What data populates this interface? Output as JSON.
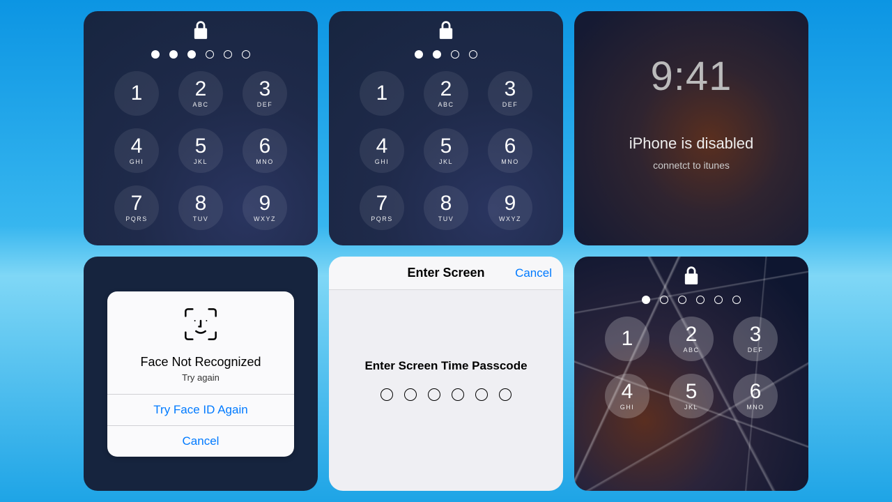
{
  "keypad": [
    {
      "num": "1",
      "sub": ""
    },
    {
      "num": "2",
      "sub": "ABC"
    },
    {
      "num": "3",
      "sub": "DEF"
    },
    {
      "num": "4",
      "sub": "GHI"
    },
    {
      "num": "5",
      "sub": "JKL"
    },
    {
      "num": "6",
      "sub": "MNO"
    },
    {
      "num": "7",
      "sub": "PQRS"
    },
    {
      "num": "8",
      "sub": "TUV"
    },
    {
      "num": "9",
      "sub": "WXYZ"
    }
  ],
  "panel1": {
    "dots_total": 6,
    "dots_filled": 3
  },
  "panel2": {
    "dots_total": 4,
    "dots_filled": 2
  },
  "panel3": {
    "time": "9:41",
    "title": "iPhone is disabled",
    "subtitle": "connetct to itunes"
  },
  "panel4": {
    "title": "Face Not Recognized",
    "subtitle": "Try again",
    "primary": "Try Face ID Again",
    "cancel": "Cancel"
  },
  "panel5": {
    "nav_title": "Enter Screen",
    "cancel": "Cancel",
    "prompt": "Enter Screen Time Passcode",
    "dots_total": 6
  },
  "panel6": {
    "dots_total": 6,
    "dots_filled": 1
  }
}
